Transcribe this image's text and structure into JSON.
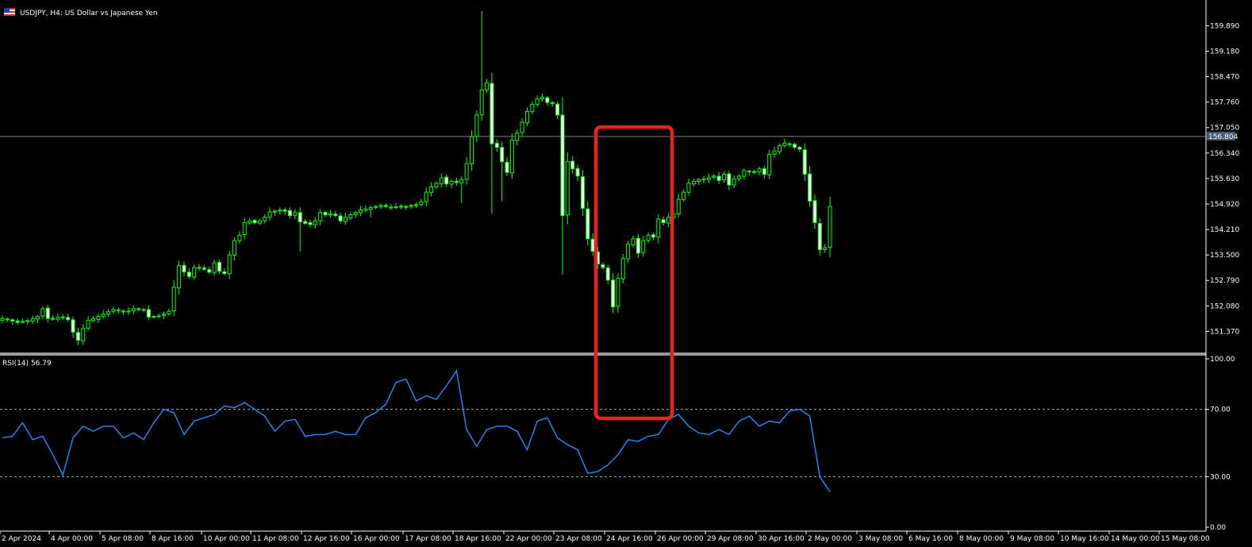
{
  "window": {
    "symbol_title": "USDJPY, H4:  US Dollar vs Japanese Yen"
  },
  "colors": {
    "background": "#000000",
    "bull": "#00ff00",
    "bear_body": "#ffffff",
    "wick": "#00ff00",
    "rsi_line": "#1e90ff",
    "grid_text": "#ffffff",
    "highlight_box": "#e8231c",
    "bid_line": "#808080",
    "bid_badge": "#4a5b73"
  },
  "chart_data": [
    {
      "type": "candlestick",
      "title": "USDJPY, H4:  US Dollar vs Japanese Yen",
      "y_ticks": [
        "159.890",
        "159.180",
        "158.470",
        "157.760",
        "157.050",
        "156.340",
        "155.630",
        "154.920",
        "154.210",
        "153.500",
        "152.790",
        "152.080",
        "151.370"
      ],
      "ylim": [
        150.87,
        160.43
      ],
      "current_bid": "156.804",
      "x_ticks": [
        "2 Apr 2024",
        "4 Apr 00:00",
        "5 Apr 08:00",
        "8 Apr 16:00",
        "10 Apr 00:00",
        "11 Apr 08:00",
        "12 Apr 16:00",
        "16 Apr 00:00",
        "17 Apr 08:00",
        "18 Apr 16:00",
        "22 Apr 00:00",
        "23 Apr 08:00",
        "24 Apr 16:00",
        "26 Apr 00:00",
        "29 Apr 08:00",
        "30 Apr 16:00",
        "2 May 00:00",
        "3 May 08:00",
        "6 May 16:00",
        "8 May 00:00",
        "9 May 08:00",
        "10 May 16:00",
        "14 May 00:00",
        "15 May 08:00"
      ],
      "close_path": [
        [
          0,
          151.73
        ],
        [
          3,
          151.62
        ],
        [
          5,
          151.67
        ],
        [
          7,
          151.78
        ],
        [
          8,
          152.0
        ],
        [
          9,
          151.73
        ],
        [
          10,
          151.72
        ],
        [
          11,
          151.76
        ],
        [
          12,
          151.77
        ],
        [
          13,
          151.7
        ],
        [
          14,
          151.35
        ],
        [
          15,
          151.12
        ],
        [
          16,
          151.45
        ],
        [
          17,
          151.68
        ],
        [
          18,
          151.72
        ],
        [
          20,
          151.85
        ],
        [
          22,
          151.98
        ],
        [
          24,
          151.92
        ],
        [
          25,
          151.93
        ],
        [
          26,
          152.0
        ],
        [
          28,
          151.97
        ],
        [
          29,
          151.77
        ],
        [
          30,
          151.78
        ],
        [
          31,
          151.8
        ],
        [
          32,
          151.85
        ],
        [
          33,
          151.93
        ],
        [
          34,
          152.6
        ],
        [
          35,
          153.2
        ],
        [
          36,
          153.03
        ],
        [
          37,
          152.9
        ],
        [
          38,
          153.15
        ],
        [
          39,
          153.15
        ],
        [
          40,
          153.1
        ],
        [
          41,
          153.02
        ],
        [
          42,
          153.28
        ],
        [
          43,
          153.05
        ],
        [
          44,
          152.98
        ],
        [
          45,
          153.5
        ],
        [
          46,
          153.9
        ],
        [
          47,
          154.05
        ],
        [
          48,
          154.4
        ],
        [
          49,
          154.45
        ],
        [
          50,
          154.4
        ],
        [
          51,
          154.45
        ],
        [
          52,
          154.55
        ],
        [
          53,
          154.7
        ],
        [
          54,
          154.72
        ],
        [
          55,
          154.75
        ],
        [
          56,
          154.72
        ],
        [
          57,
          154.6
        ],
        [
          58,
          154.68
        ],
        [
          59,
          154.42
        ],
        [
          60,
          154.38
        ],
        [
          61,
          154.35
        ],
        [
          62,
          154.45
        ],
        [
          63,
          154.68
        ],
        [
          64,
          154.62
        ],
        [
          65,
          154.65
        ],
        [
          66,
          154.6
        ],
        [
          67,
          154.45
        ],
        [
          68,
          154.55
        ],
        [
          69,
          154.62
        ],
        [
          70,
          154.68
        ],
        [
          71,
          154.75
        ],
        [
          72,
          154.78
        ],
        [
          73,
          154.82
        ],
        [
          74,
          154.85
        ],
        [
          75,
          154.88
        ],
        [
          76,
          154.85
        ],
        [
          77,
          154.82
        ],
        [
          78,
          154.84
        ],
        [
          79,
          154.86
        ],
        [
          80,
          154.85
        ],
        [
          81,
          154.88
        ],
        [
          82,
          154.9
        ],
        [
          83,
          154.98
        ],
        [
          84,
          155.25
        ],
        [
          85,
          155.4
        ],
        [
          86,
          155.5
        ],
        [
          87,
          155.65
        ],
        [
          88,
          155.48
        ],
        [
          89,
          155.55
        ],
        [
          90,
          155.52
        ],
        [
          91,
          155.6
        ],
        [
          92,
          156.05
        ],
        [
          93,
          156.8
        ],
        [
          94,
          157.4
        ],
        [
          95,
          158.1
        ],
        [
          96,
          158.3
        ],
        [
          97,
          156.6
        ],
        [
          98,
          156.5
        ],
        [
          99,
          156.1
        ],
        [
          100,
          155.8
        ],
        [
          101,
          156.7
        ],
        [
          102,
          156.9
        ],
        [
          103,
          157.2
        ],
        [
          104,
          157.5
        ],
        [
          105,
          157.7
        ],
        [
          106,
          157.85
        ],
        [
          107,
          157.9
        ],
        [
          108,
          157.75
        ],
        [
          109,
          157.72
        ],
        [
          110,
          157.4
        ],
        [
          111,
          154.6
        ],
        [
          112,
          156.1
        ],
        [
          113,
          155.9
        ],
        [
          114,
          155.7
        ],
        [
          115,
          154.8
        ],
        [
          116,
          153.95
        ],
        [
          117,
          153.6
        ],
        [
          118,
          153.25
        ],
        [
          119,
          153.15
        ],
        [
          120,
          152.8
        ],
        [
          121,
          152.05
        ],
        [
          122,
          152.85
        ],
        [
          123,
          153.4
        ],
        [
          124,
          153.8
        ],
        [
          125,
          153.95
        ],
        [
          126,
          153.55
        ],
        [
          127,
          153.9
        ],
        [
          128,
          154.05
        ],
        [
          129,
          154.0
        ],
        [
          130,
          154.5
        ],
        [
          131,
          154.4
        ],
        [
          132,
          154.55
        ],
        [
          133,
          154.65
        ],
        [
          134,
          155.05
        ],
        [
          135,
          155.25
        ],
        [
          136,
          155.5
        ],
        [
          137,
          155.55
        ],
        [
          138,
          155.6
        ],
        [
          139,
          155.62
        ],
        [
          140,
          155.65
        ],
        [
          141,
          155.7
        ],
        [
          142,
          155.58
        ],
        [
          143,
          155.75
        ],
        [
          144,
          155.45
        ],
        [
          145,
          155.62
        ],
        [
          146,
          155.7
        ],
        [
          147,
          155.85
        ],
        [
          148,
          155.82
        ],
        [
          149,
          155.8
        ],
        [
          150,
          155.9
        ],
        [
          151,
          155.75
        ],
        [
          152,
          156.3
        ],
        [
          153,
          156.4
        ],
        [
          154,
          156.55
        ],
        [
          155,
          156.62
        ],
        [
          156,
          156.58
        ],
        [
          157,
          156.5
        ],
        [
          158,
          156.45
        ],
        [
          159,
          155.75
        ],
        [
          160,
          155.0
        ],
        [
          161,
          154.4
        ],
        [
          162,
          153.65
        ],
        [
          163,
          153.7
        ],
        [
          164,
          154.85
        ]
      ]
    },
    {
      "type": "line",
      "title": "RSI(14) 56.79",
      "name": "RSI(14)",
      "ylim": [
        0,
        100
      ],
      "y_ticks": [
        "100.00",
        "70.00",
        "30.00",
        "0.00"
      ],
      "levels": [
        70,
        30
      ],
      "x": [
        0,
        2,
        4,
        6,
        8,
        10,
        12,
        14,
        16,
        18,
        20,
        22,
        24,
        26,
        28,
        30,
        32,
        34,
        36,
        38,
        40,
        42,
        44,
        46,
        48,
        50,
        52,
        54,
        56,
        58,
        60,
        62,
        64,
        66,
        68,
        70,
        72,
        74,
        76,
        78,
        80,
        82,
        84,
        86,
        88,
        90,
        92,
        94,
        96,
        98,
        100,
        102,
        104,
        106,
        108,
        110,
        112,
        114,
        116,
        118,
        120,
        122,
        124,
        126,
        128,
        130,
        132,
        134,
        136,
        138,
        140,
        142,
        144,
        146,
        148,
        150,
        152,
        154,
        156,
        158,
        160,
        162,
        164
      ],
      "values": [
        53,
        54,
        62,
        52,
        54,
        43,
        31,
        53,
        60,
        57,
        60,
        60,
        53,
        56,
        52,
        62,
        70,
        68,
        55,
        63,
        65,
        67,
        72,
        71,
        74,
        70,
        66,
        57,
        63,
        64,
        54,
        55,
        55,
        57,
        55,
        55,
        65,
        68,
        73,
        86,
        88,
        75,
        78,
        76,
        84,
        93,
        58,
        48,
        58,
        60,
        60,
        57,
        46,
        63,
        65,
        53,
        49,
        46,
        32,
        33,
        37,
        43,
        52,
        51,
        54,
        55,
        64,
        67,
        60,
        56,
        55,
        58,
        55,
        63,
        66,
        60,
        63,
        62,
        69,
        70,
        66,
        30,
        21
      ]
    }
  ]
}
